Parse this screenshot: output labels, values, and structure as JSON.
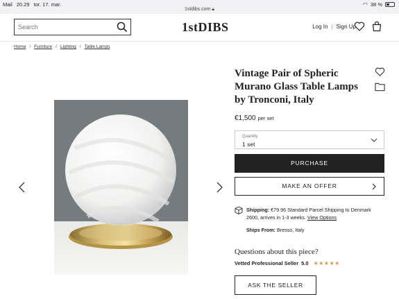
{
  "status_bar": {
    "carrier": "Mail",
    "time": "20.29",
    "date": "tor. 17. mar.",
    "url": "1stdibs.com",
    "battery": "38 %"
  },
  "header": {
    "search_placeholder": "Search",
    "logo": "1stDIBS",
    "login": "Log In",
    "separator": "|",
    "signup": "Sign Up"
  },
  "breadcrumb": [
    "Home",
    "Furniture",
    "Lighting",
    "Table Lamps"
  ],
  "product": {
    "title": "Vintage Pair of Spheric Murano Glass Table Lamps by Tronconi, Italy",
    "price": "€1,500",
    "price_unit": "per set",
    "quantity_label": "Quantity",
    "quantity_value": "1 set",
    "purchase_label": "PURCHASE",
    "offer_label": "MAKE AN OFFER"
  },
  "shipping": {
    "label": "Shipping:",
    "text": "€79.96 Standard Parcel Shipping to Denmark 2600, arrives in 1-3 weeks.",
    "link": "View Options",
    "ships_from_label": "Ships From:",
    "ships_from_value": "Bresso, Italy"
  },
  "seller": {
    "questions": "Questions about this piece?",
    "vetted_label": "Vetted Professional Seller",
    "rating": "5.0",
    "stars": "★★★★★",
    "ask_label": "ASK THE SELLER"
  },
  "icons": {
    "search": "search-icon",
    "heart": "heart-icon",
    "bag": "shopping-bag-icon",
    "folder": "folder-icon",
    "truck": "shipping-box-icon"
  },
  "colors": {
    "dark_button": "#222222",
    "star_gold": "#c8a04a",
    "photo_background": "#6e767a"
  }
}
